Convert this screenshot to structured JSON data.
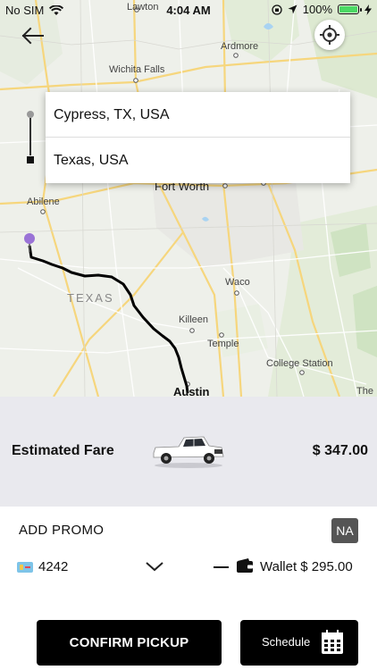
{
  "status_bar": {
    "carrier": "No SIM",
    "time": "4:04 AM",
    "battery_percent": "100%",
    "battery_level": 1.0
  },
  "map": {
    "labels": {
      "lawton": "Lawton",
      "ardmore": "Ardmore",
      "wichita_falls": "Wichita Falls",
      "fort_worth": "Fort Worth",
      "abilene": "Abilene",
      "texas": "TEXAS",
      "waco": "Waco",
      "killeen": "Killeen",
      "temple": "Temple",
      "college_station": "College Station",
      "austin": "Austin",
      "the": "The"
    }
  },
  "route": {
    "pickup": "Cypress, TX, USA",
    "destination": "Texas, USA"
  },
  "fare": {
    "label": "Estimated Fare",
    "amount": "$ 347.00"
  },
  "promo": {
    "label": "ADD PROMO",
    "badge": "NA"
  },
  "payment": {
    "card_number": "4242",
    "wallet_text": "Wallet $ 295.00"
  },
  "actions": {
    "confirm": "CONFIRM PICKUP",
    "schedule": "Schedule"
  },
  "colors": {
    "map_bg": "#eef0ea",
    "pin": "#9a73d6",
    "fare_panel": "#e9e9ee",
    "button": "#000000",
    "badge": "#555555"
  },
  "icons": [
    "wifi-icon",
    "location-arrow-icon",
    "battery-icon",
    "back-arrow-icon",
    "crosshair-icon",
    "pickup-dot-icon",
    "destination-square-icon",
    "truck-icon",
    "card-icon",
    "chevron-down-icon",
    "wallet-icon",
    "calendar-icon",
    "pin-icon"
  ]
}
